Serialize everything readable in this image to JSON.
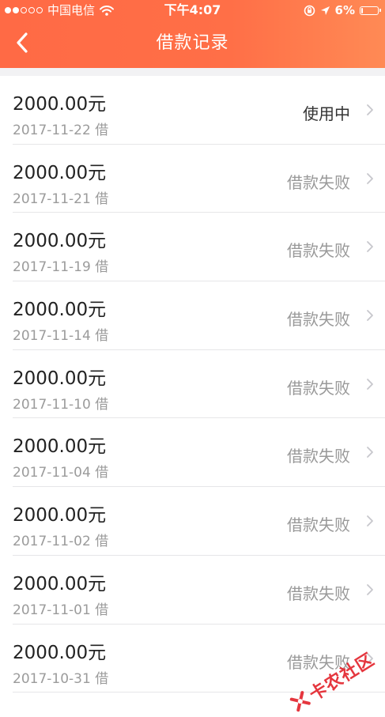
{
  "status_bar": {
    "carrier": "中国电信",
    "time": "下午4:07",
    "battery": "6%",
    "battery_level": 0.06,
    "signal_bars": 2
  },
  "nav": {
    "title": "借款记录"
  },
  "records": [
    {
      "amount": "2000.00元",
      "date": "2017-11-22 借",
      "status": "使用中",
      "status_type": "active"
    },
    {
      "amount": "2000.00元",
      "date": "2017-11-21 借",
      "status": "借款失败",
      "status_type": "failed"
    },
    {
      "amount": "2000.00元",
      "date": "2017-11-19 借",
      "status": "借款失败",
      "status_type": "failed"
    },
    {
      "amount": "2000.00元",
      "date": "2017-11-14 借",
      "status": "借款失败",
      "status_type": "failed"
    },
    {
      "amount": "2000.00元",
      "date": "2017-11-10 借",
      "status": "借款失败",
      "status_type": "failed"
    },
    {
      "amount": "2000.00元",
      "date": "2017-11-04 借",
      "status": "借款失败",
      "status_type": "failed"
    },
    {
      "amount": "2000.00元",
      "date": "2017-11-02 借",
      "status": "借款失败",
      "status_type": "failed"
    },
    {
      "amount": "2000.00元",
      "date": "2017-11-01 借",
      "status": "借款失败",
      "status_type": "failed"
    },
    {
      "amount": "2000.00元",
      "date": "2017-10-31 借",
      "status": "借款失败",
      "status_type": "failed"
    }
  ],
  "watermark": {
    "text": "卡农社区"
  },
  "colors": {
    "header": "#ff6a45",
    "watermark": "#e3262e"
  }
}
